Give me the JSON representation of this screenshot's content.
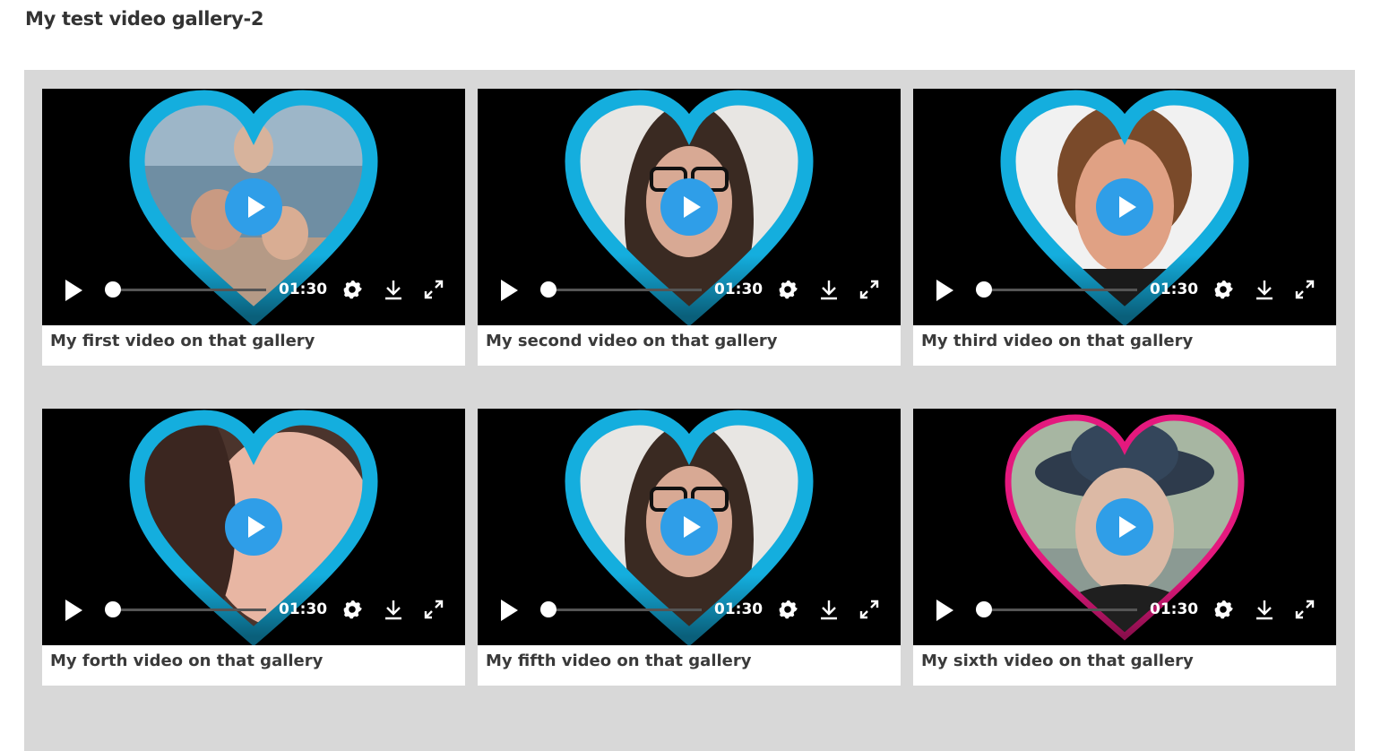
{
  "page": {
    "title": "My test video gallery-2"
  },
  "colors": {
    "gallery_bg": "#d8d8d8",
    "heart_blue": "#14aede",
    "heart_pink": "#e4197e",
    "play_button": "#2f9ee8"
  },
  "videos": [
    {
      "caption": "My first video on that gallery",
      "time": "01:30",
      "heart_color": "blue",
      "photo": "woman-with-two-children-at-beach"
    },
    {
      "caption": "My second video on that gallery",
      "time": "01:30",
      "heart_color": "blue",
      "photo": "woman-with-glasses"
    },
    {
      "caption": "My third video on that gallery",
      "time": "01:30",
      "heart_color": "blue",
      "photo": "smiling-woman-short-hair"
    },
    {
      "caption": "My forth video on that gallery",
      "time": "01:30",
      "heart_color": "blue",
      "photo": "smiling-young-woman"
    },
    {
      "caption": "My fifth video on that gallery",
      "time": "01:30",
      "heart_color": "blue",
      "photo": "woman-with-glasses"
    },
    {
      "caption": "My sixth video on that gallery",
      "time": "01:30",
      "heart_color": "pink",
      "photo": "woman-in-hat"
    }
  ],
  "icons": {
    "play": "play-icon",
    "settings": "gear-icon",
    "download": "download-icon",
    "fullscreen": "fullscreen-icon"
  }
}
